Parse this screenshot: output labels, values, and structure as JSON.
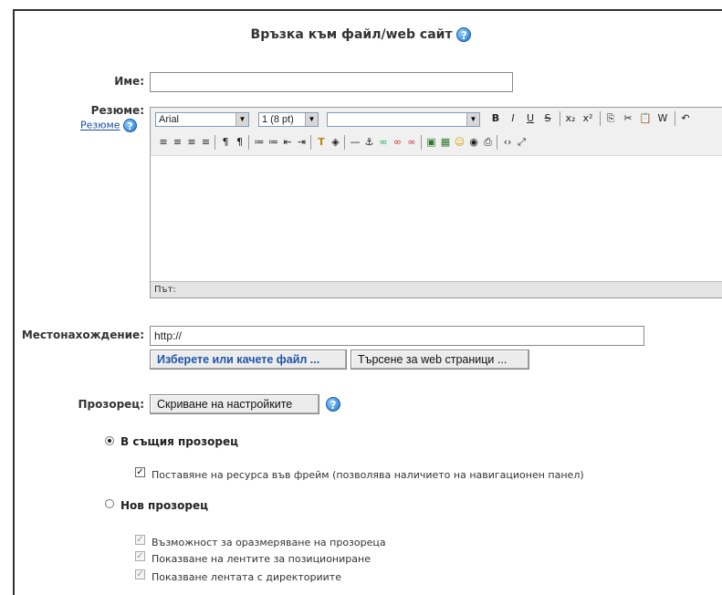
{
  "form": {
    "title": "Връзка към файл/web сайт",
    "name_label": "Име:",
    "name_value": "",
    "summary_label": "Резюме:",
    "summary_help_link": "Резюме",
    "location_label": "Местонахождение:",
    "location_value": "http://",
    "choose_file_button": "Изберете или качете файл ...",
    "search_web_button": "Търсене за web страници ...",
    "window_label": "Прозорец:",
    "hide_settings_button": "Скриване на настройките"
  },
  "editor": {
    "font_family": "Arial",
    "font_size": "1 (8 pt)",
    "style_value": "",
    "path_label": "Път:",
    "toolbar1_icons": [
      "bold-icon",
      "italic-icon",
      "underline-icon",
      "strikethrough-icon",
      "subscript-icon",
      "superscript-icon",
      "copy-icon",
      "cut-icon",
      "paste-icon",
      "paste-word-icon",
      "undo-icon"
    ],
    "toolbar1_glyphs": [
      "B",
      "I",
      "U",
      "S",
      "x₂",
      "x²",
      "⎘",
      "✂",
      "📋",
      "W",
      "↶"
    ],
    "toolbar2_icons": [
      "align-left-icon",
      "align-center-icon",
      "align-right-icon",
      "justify-icon",
      "ltr-icon",
      "rtl-icon",
      "ordered-list-icon",
      "unordered-list-icon",
      "outdent-icon",
      "indent-icon",
      "text-color-icon",
      "background-color-icon",
      "horizontal-rule-icon",
      "anchor-icon",
      "link-icon",
      "unlink-icon",
      "nolink-icon",
      "image-icon",
      "table-icon",
      "smiley-icon",
      "emoticon-icon",
      "search-replace-icon",
      "html-source-icon",
      "fullscreen-icon"
    ],
    "toolbar2_glyphs": [
      "≡",
      "≡",
      "≡",
      "≡",
      "¶",
      "¶",
      "≔",
      "≔",
      "⇤",
      "⇥",
      "T",
      "◈",
      "—",
      "⚓",
      "∞",
      "∞",
      "∞",
      "▣",
      "▦",
      "☺",
      "◉",
      "⎙",
      "‹›",
      "⤢"
    ]
  },
  "window_options": {
    "same_window_label": "В същия прозорец",
    "same_window_selected": true,
    "frame_label": "Поставяне на ресурса във фрейм (позволява наличието на навигационен панел)",
    "frame_checked": true,
    "new_window_label": "Нов прозорец",
    "new_window_selected": false,
    "resizable_label": "Възможност за оразмеряване на прозореца",
    "scrollbars_label": "Показване на лентите за позициониране",
    "directories_label": "Показване лентата с директориите"
  }
}
